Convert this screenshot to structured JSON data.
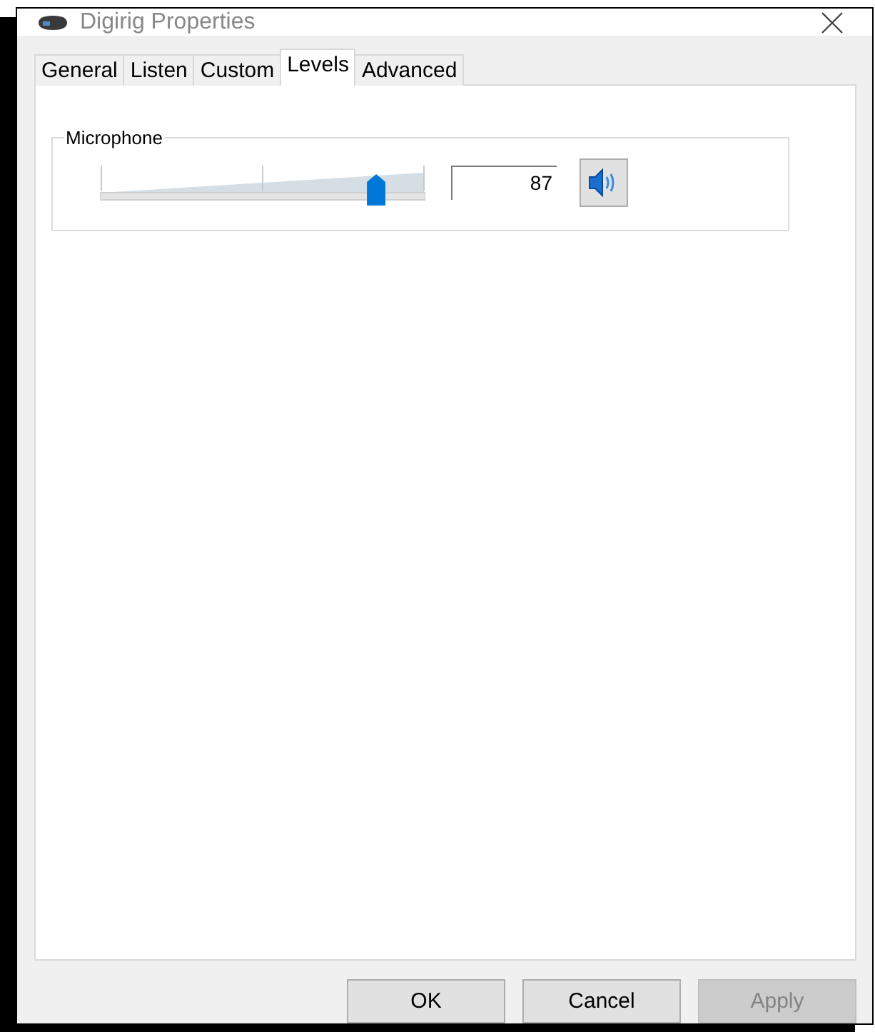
{
  "window": {
    "title": "Digirig Properties"
  },
  "tabs": [
    {
      "label": "General",
      "selected": false
    },
    {
      "label": "Listen",
      "selected": false
    },
    {
      "label": "Custom",
      "selected": false
    },
    {
      "label": "Levels",
      "selected": true
    },
    {
      "label": "Advanced",
      "selected": false
    }
  ],
  "levels": [
    {
      "name": "Microphone",
      "level": 0.87,
      "value": "87",
      "muted": false
    }
  ],
  "buttons": [
    {
      "label": "OK",
      "disabled": false
    },
    {
      "label": "Cancel",
      "disabled": false
    },
    {
      "label": "Apply",
      "disabled": true
    }
  ]
}
